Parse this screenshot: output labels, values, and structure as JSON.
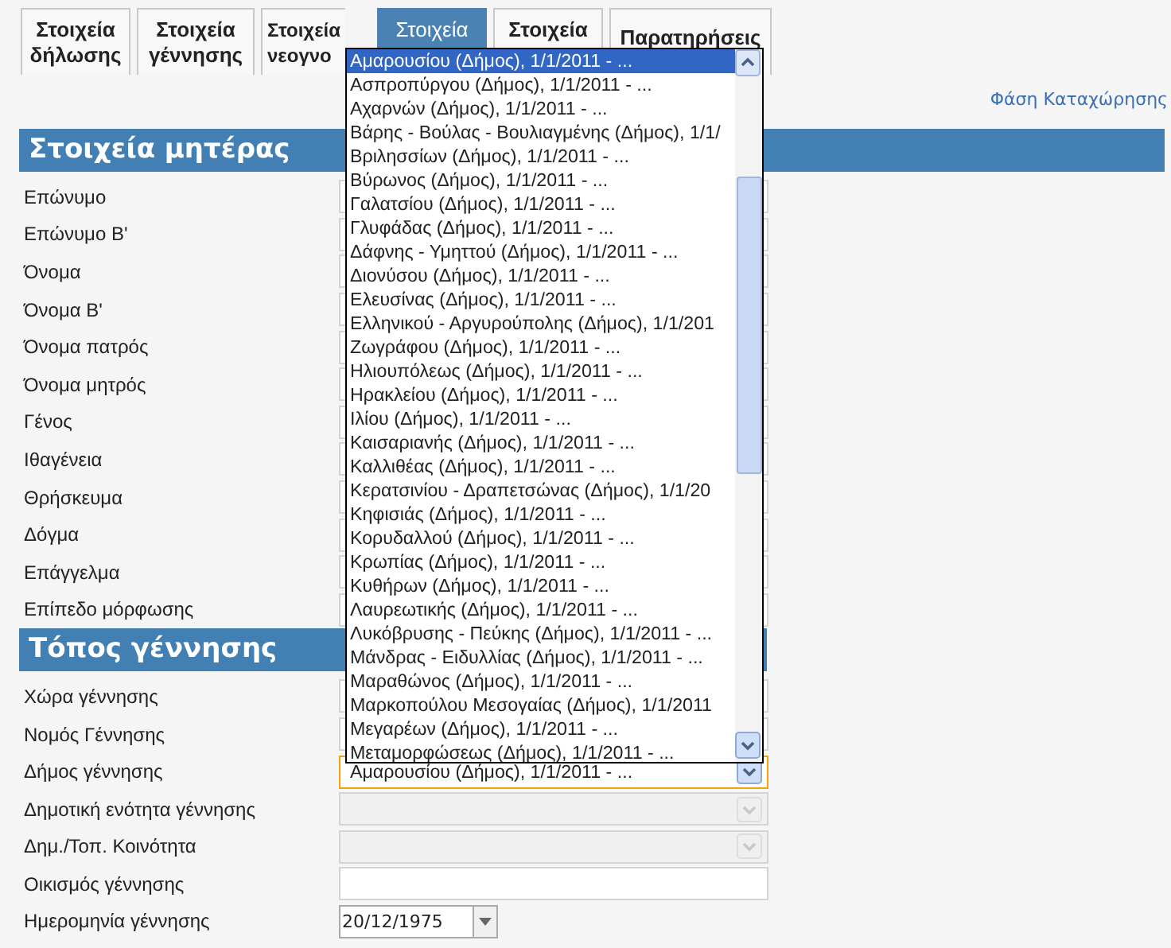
{
  "tabs": [
    {
      "lines": [
        "Στοιχεία",
        "δήλωσης"
      ],
      "selected": false
    },
    {
      "lines": [
        "Στοιχεία",
        "γέννησης"
      ],
      "selected": false
    },
    {
      "lines": [
        "Στοιχεία",
        "νεογνο"
      ],
      "selected": false
    },
    {
      "lines": [
        "Στοιχεία"
      ],
      "selected": true
    },
    {
      "lines": [
        "Στοιχεία"
      ],
      "selected": false
    },
    {
      "lines": [
        "Παρατηρήσεις"
      ],
      "selected": false
    }
  ],
  "phase_link": "Φάση Καταχώρησης",
  "sections": [
    {
      "title": "Στοιχεία μητέρας",
      "fields": [
        {
          "label": "Επώνυμο",
          "kind": "text"
        },
        {
          "label": "Επώνυμο Β'",
          "kind": "text"
        },
        {
          "label": "Όνομα",
          "kind": "text"
        },
        {
          "label": "Όνομα Β'",
          "kind": "text"
        },
        {
          "label": "Όνομα πατρός",
          "kind": "text"
        },
        {
          "label": "Όνομα μητρός",
          "kind": "text"
        },
        {
          "label": "Γένος",
          "kind": "text"
        },
        {
          "label": "Ιθαγένεια",
          "kind": "text"
        },
        {
          "label": "Θρήσκευμα",
          "kind": "text"
        },
        {
          "label": "Δόγμα",
          "kind": "text"
        },
        {
          "label": "Επάγγελμα",
          "kind": "text"
        },
        {
          "label": "Επίπεδο μόρφωσης",
          "kind": "text"
        }
      ]
    },
    {
      "title": "Τόπος γέννησης",
      "fields": [
        {
          "label": "Χώρα γέννησης",
          "kind": "text"
        },
        {
          "label": "Νομός Γέννησης",
          "kind": "text"
        },
        {
          "label": "Δήμος γέννησης",
          "kind": "select",
          "value": "Αμαρουσίου (Δήμος), 1/1/2011 - ...",
          "focused": true,
          "disabled": false
        },
        {
          "label": "Δημοτική ενότητα γέννησης",
          "kind": "select",
          "focused": false,
          "disabled": true
        },
        {
          "label": "Δημ./Τοπ. Κοινότητα",
          "kind": "select",
          "focused": false,
          "disabled": true
        },
        {
          "label": "Οικισμός γέννησης",
          "kind": "text"
        },
        {
          "label": "Ημερομηνία γέννησης",
          "kind": "date",
          "value": "20/12/1975"
        }
      ]
    }
  ],
  "dropdown": {
    "items": [
      {
        "text": "Αμαρουσίου (Δήμος), 1/1/2011 - ...",
        "selected": true
      },
      {
        "text": "Ασπροπύργου (Δήμος), 1/1/2011 - ...",
        "selected": false
      },
      {
        "text": "Αχαρνών (Δήμος), 1/1/2011 - ...",
        "selected": false
      },
      {
        "text": "Βάρης - Βούλας - Βουλιαγμένης (Δήμος), 1/1/",
        "selected": false
      },
      {
        "text": "Βριλησσίων (Δήμος), 1/1/2011 - ...",
        "selected": false
      },
      {
        "text": "Βύρωνος (Δήμος), 1/1/2011 - ...",
        "selected": false
      },
      {
        "text": "Γαλατσίου (Δήμος), 1/1/2011 - ...",
        "selected": false
      },
      {
        "text": "Γλυφάδας (Δήμος), 1/1/2011 - ...",
        "selected": false
      },
      {
        "text": "Δάφνης - Υμηττού (Δήμος), 1/1/2011 - ...",
        "selected": false
      },
      {
        "text": "Διονύσου (Δήμος), 1/1/2011 - ...",
        "selected": false
      },
      {
        "text": "Ελευσίνας (Δήμος), 1/1/2011 - ...",
        "selected": false
      },
      {
        "text": "Ελληνικού - Αργυρούπολης (Δήμος), 1/1/201",
        "selected": false
      },
      {
        "text": "Ζωγράφου (Δήμος), 1/1/2011 - ...",
        "selected": false
      },
      {
        "text": "Ηλιουπόλεως (Δήμος), 1/1/2011 - ...",
        "selected": false
      },
      {
        "text": "Ηρακλείου (Δήμος), 1/1/2011 - ...",
        "selected": false
      },
      {
        "text": "Ιλίου (Δήμος), 1/1/2011 - ...",
        "selected": false
      },
      {
        "text": "Καισαριανής (Δήμος), 1/1/2011 - ...",
        "selected": false
      },
      {
        "text": "Καλλιθέας (Δήμος), 1/1/2011 - ...",
        "selected": false
      },
      {
        "text": "Κερατσινίου - Δραπετσώνας (Δήμος), 1/1/20",
        "selected": false
      },
      {
        "text": "Κηφισιάς (Δήμος), 1/1/2011 - ...",
        "selected": false
      },
      {
        "text": "Κορυδαλλού (Δήμος), 1/1/2011 - ...",
        "selected": false
      },
      {
        "text": "Κρωπίας (Δήμος), 1/1/2011 - ...",
        "selected": false
      },
      {
        "text": "Κυθήρων (Δήμος), 1/1/2011 - ...",
        "selected": false
      },
      {
        "text": "Λαυρεωτικής (Δήμος), 1/1/2011 - ...",
        "selected": false
      },
      {
        "text": "Λυκόβρυσης - Πεύκης (Δήμος), 1/1/2011 - ...",
        "selected": false
      },
      {
        "text": "Μάνδρας - Ειδυλλίας (Δήμος), 1/1/2011 - ...",
        "selected": false
      },
      {
        "text": "Μαραθώνος (Δήμος), 1/1/2011 - ...",
        "selected": false
      },
      {
        "text": "Μαρκοπούλου Μεσογαίας (Δήμος), 1/1/2011",
        "selected": false
      },
      {
        "text": "Μεγαρέων (Δήμος), 1/1/2011 - ...",
        "selected": false
      },
      {
        "text": "Μεταμορφώσεως (Δήμος), 1/1/2011 - ...",
        "selected": false
      }
    ]
  }
}
